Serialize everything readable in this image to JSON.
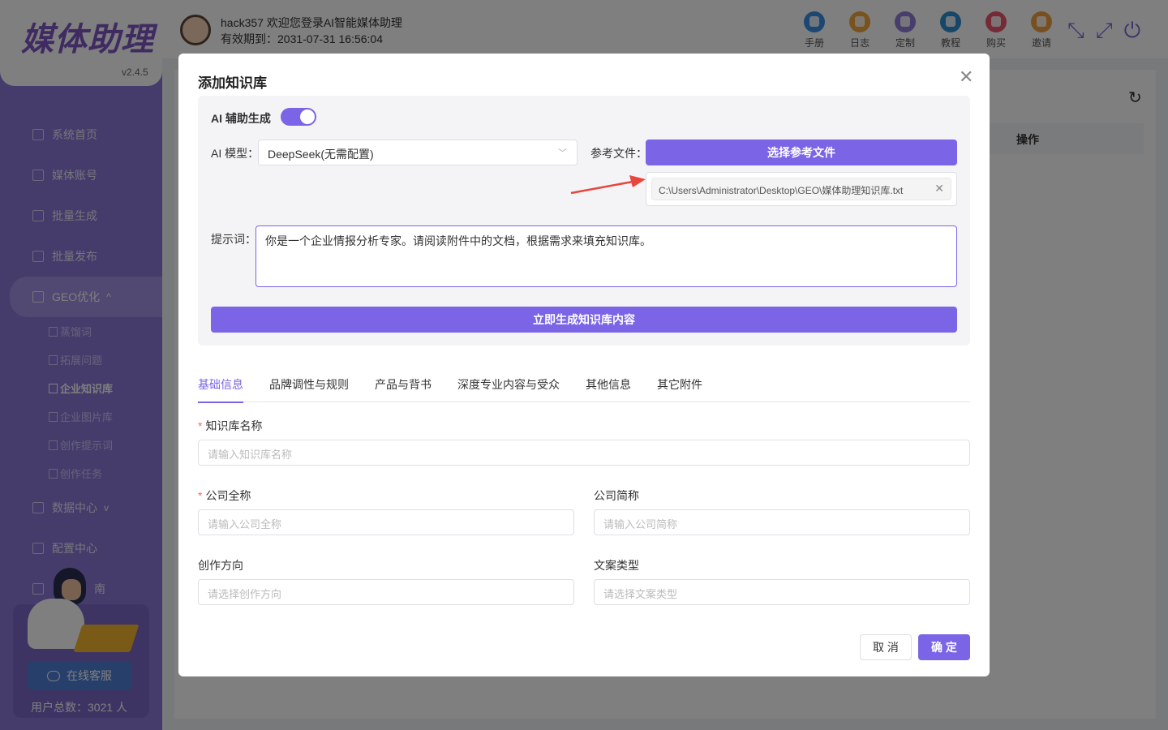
{
  "app": {
    "logo": "媒体助理",
    "version": "v2.4.5"
  },
  "topbar": {
    "welcome": "hack357 欢迎您登录AI智能媒体助理",
    "expiry": "有效期到：2031-07-31 16:56:04",
    "tools": [
      {
        "label": "手册",
        "icon": "manual-icon",
        "color": "#3a8ee6"
      },
      {
        "label": "日志",
        "icon": "log-icon",
        "color": "#f0a73a"
      },
      {
        "label": "定制",
        "icon": "customize-icon",
        "color": "#8e7cd8"
      },
      {
        "label": "教程",
        "icon": "tutorial-icon",
        "color": "#2f8fd1"
      },
      {
        "label": "购买",
        "icon": "purchase-icon",
        "color": "#e8566b"
      },
      {
        "label": "邀请",
        "icon": "invite-icon",
        "color": "#f0a040"
      }
    ]
  },
  "sidebar": {
    "items": [
      {
        "label": "系统首页",
        "icon": "home-icon"
      },
      {
        "label": "媒体账号",
        "icon": "account-icon"
      },
      {
        "label": "批量生成",
        "icon": "edit-icon"
      },
      {
        "label": "批量发布",
        "icon": "send-icon"
      }
    ],
    "geo": {
      "label": "GEO优化",
      "icon": "list-icon",
      "caret": "^"
    },
    "sub_items": [
      {
        "label": "蒸馏词"
      },
      {
        "label": "拓展问题"
      },
      {
        "label": "企业知识库"
      },
      {
        "label": "企业图片库"
      },
      {
        "label": "创作提示词"
      },
      {
        "label": "创作任务"
      }
    ],
    "data_center": {
      "label": "数据中心",
      "caret": "v"
    },
    "config_center": {
      "label": "配置中心"
    },
    "partial_item": "南",
    "support": {
      "button": "在线客服",
      "user_count": "用户总数：3021 人"
    }
  },
  "content": {
    "ops_header": "操作"
  },
  "modal": {
    "title": "添加知识库",
    "ai_assist_label": "AI 辅助生成",
    "ai_assist_on": true,
    "model_label": "AI 模型：",
    "model_value": "DeepSeek(无需配置)",
    "ref_file_label": "参考文件：",
    "select_file_button": "选择参考文件",
    "file_path": "C:\\Users\\Administrator\\Desktop\\GEO\\媒体助理知识库.txt",
    "prompt_label": "提示词：",
    "prompt_value": "你是一个企业情报分析专家。请阅读附件中的文档，根据需求来填充知识库。",
    "generate_button": "立即生成知识库内容",
    "tabs": [
      {
        "label": "基础信息",
        "active": true
      },
      {
        "label": "品牌调性与规则",
        "active": false
      },
      {
        "label": "产品与背书",
        "active": false
      },
      {
        "label": "深度专业内容与受众",
        "active": false
      },
      {
        "label": "其他信息",
        "active": false
      },
      {
        "label": "其它附件",
        "active": false
      }
    ],
    "fields": {
      "kb_name": {
        "label": "知识库名称",
        "required": true,
        "placeholder": "请输入知识库名称"
      },
      "company_full": {
        "label": "公司全称",
        "required": true,
        "placeholder": "请输入公司全称"
      },
      "company_short": {
        "label": "公司简称",
        "required": false,
        "placeholder": "请输入公司简称"
      },
      "direction": {
        "label": "创作方向",
        "required": false,
        "placeholder": "请选择创作方向"
      },
      "copy_type": {
        "label": "文案类型",
        "required": false,
        "placeholder": "请选择文案类型"
      }
    },
    "cancel_button": "取 消",
    "confirm_button": "确 定"
  },
  "colors": {
    "accent": "#7b64e6",
    "sidebar": "#8a79d8",
    "required": "#f56c6c"
  }
}
